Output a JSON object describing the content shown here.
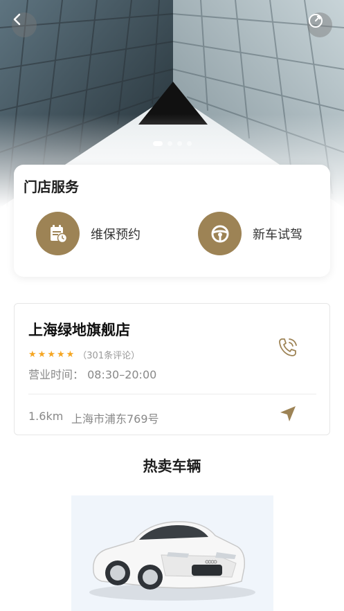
{
  "hero": {
    "carousel_dots": 4,
    "active_dot": 0
  },
  "service": {
    "title": "门店服务",
    "items": [
      {
        "label": "维保预约",
        "icon": "calendar-clock-icon"
      },
      {
        "label": "新车试驾",
        "icon": "steering-wheel-icon"
      }
    ]
  },
  "store": {
    "name": "上海绿地旗舰店",
    "rating": 5,
    "reviews": "（301条评论）",
    "hours": "营业时间：  08:30–20:00",
    "distance": "1.6km",
    "address": "上海市浦东769号"
  },
  "hot": {
    "title": "热卖车辆"
  },
  "colors": {
    "accent": "#9d8355",
    "star": "#f5a623"
  }
}
